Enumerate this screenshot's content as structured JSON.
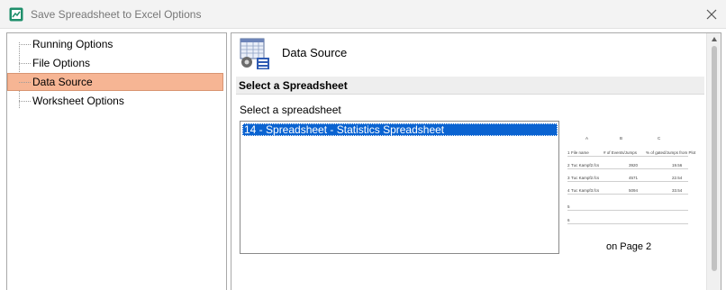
{
  "window": {
    "title": "Save Spreadsheet to Excel Options"
  },
  "tree": {
    "items": [
      {
        "label": "Running Options",
        "selected": false
      },
      {
        "label": "File Options",
        "selected": false
      },
      {
        "label": "Data Source",
        "selected": true
      },
      {
        "label": "Worksheet Options",
        "selected": false
      }
    ]
  },
  "content": {
    "header_title": "Data Source",
    "section_title": "Select a Spreadsheet",
    "field_label": "Select a spreadsheet",
    "listbox_items": [
      "14 - Spreadsheet - Statistics Spreadsheet"
    ],
    "preview": {
      "columns": [
        "A",
        "B",
        "C"
      ],
      "headers": [
        "File name",
        "# of Events/Jumps",
        "% of gated/Jumps from Plot"
      ],
      "rows": [
        {
          "num": "1",
          "name": "File name",
          "b": "# of Events/Jumps",
          "c": "% of gated/Jumps from Plot"
        },
        {
          "num": "2",
          "name": "Tuc Kampf2.fcs",
          "b": "3920",
          "c": "19.56"
        },
        {
          "num": "3",
          "name": "Tuc Kampf2.fcs",
          "b": "4571",
          "c": "22.54"
        },
        {
          "num": "4",
          "name": "Tuc Kampf3.fcs",
          "b": "5094",
          "c": "33.54"
        },
        {
          "num": "5",
          "name": "",
          "b": "",
          "c": ""
        },
        {
          "num": "6",
          "name": "",
          "b": "",
          "c": ""
        }
      ],
      "page_label": "on Page 2"
    }
  },
  "colors": {
    "selected_tree_bg": "#f6b594",
    "selected_list_bg": "#0a63d1"
  }
}
